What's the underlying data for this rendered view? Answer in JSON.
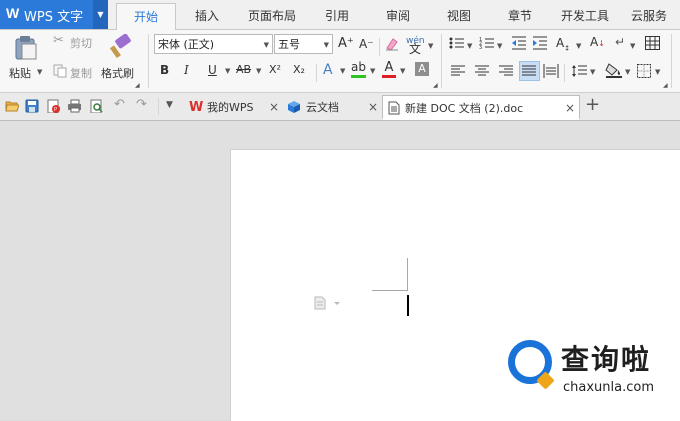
{
  "app": {
    "title": "WPS 文字",
    "logo": "W"
  },
  "menu_tabs": [
    "开始",
    "插入",
    "页面布局",
    "引用",
    "审阅",
    "视图",
    "章节",
    "开发工具",
    "云服务"
  ],
  "ribbon": {
    "paste_label": "粘贴",
    "cut_label": "剪切",
    "copy_label": "复制",
    "format_painter_label": "格式刷",
    "font_name": "宋体 (正文)",
    "font_size": "五号",
    "grow_font": "A⁺",
    "shrink_font": "A⁻",
    "pinyin_glyph": "wén",
    "bold": "B",
    "italic": "I",
    "underline": "U",
    "strike": "AB",
    "superscript": "X²",
    "subscript": "X₂",
    "text_effect": "A",
    "highlight": "ab",
    "font_color": "A",
    "char_shade": "A"
  },
  "doc_tabs": [
    {
      "label": "我的WPS",
      "active": false
    },
    {
      "label": "云文档",
      "active": false
    },
    {
      "label": "新建 DOC 文档 (2).doc",
      "active": true
    }
  ],
  "new_tab_glyph": "+",
  "close_glyph": "×",
  "watermark": {
    "title": "查询啦",
    "url": "chaxunla.com"
  },
  "colors": {
    "accent": "#2b79d8",
    "wm_blue": "#1a73d8",
    "wm_orange": "#f0a519",
    "wps_red": "#d9302b"
  }
}
